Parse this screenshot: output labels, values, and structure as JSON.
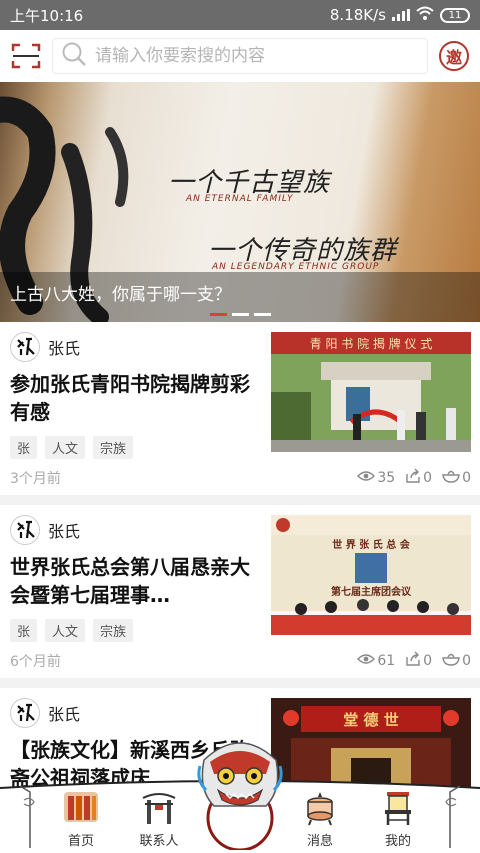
{
  "status": {
    "time": "上午10:16",
    "speed": "8.18K/s",
    "battery": "11"
  },
  "search": {
    "placeholder": "请输入你要索搜的内容",
    "invite_label": "邀"
  },
  "banner": {
    "line1": "一个千古望族",
    "sub1": "AN ETERNAL FAMILY",
    "line2": "一个传奇的族群",
    "sub2": "AN LEGENDARY ETHNIC GROUP",
    "caption": "上古八大姓，你属于哪一支？",
    "slides": 3,
    "active_slide": 0
  },
  "feed": [
    {
      "author": "张氏",
      "title": "参加张氏青阳书院揭牌剪彩有感",
      "tags": [
        "张",
        "人文",
        "宗族"
      ],
      "age": "3个月前",
      "views": "35",
      "shares": "0",
      "likes": "0",
      "thumb": "plaque-ceremony"
    },
    {
      "author": "张氏",
      "title": "世界张氏总会第八届恳亲大会暨第七届理事…",
      "tags": [
        "张",
        "人文",
        "宗族"
      ],
      "age": "6个月前",
      "views": "61",
      "shares": "0",
      "likes": "0",
      "thumb": "conference-stage"
    },
    {
      "author": "张氏",
      "title": "【张族文化】新溪西乡丘驹斋公祖祠落成庆",
      "thumb": "ancestral-hall"
    }
  ],
  "nav": {
    "items": [
      {
        "label": "首页",
        "icon": "book-icon"
      },
      {
        "label": "联系人",
        "icon": "gate-icon"
      },
      {
        "label": "",
        "icon": "lion-mask-icon"
      },
      {
        "label": "消息",
        "icon": "drum-icon"
      },
      {
        "label": "我的",
        "icon": "chair-icon"
      }
    ]
  },
  "colors": {
    "accent": "#b0362b",
    "statusbar": "#6b6b6b",
    "text": "#111111"
  }
}
